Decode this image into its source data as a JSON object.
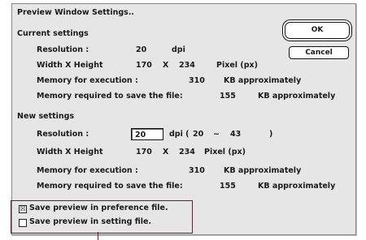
{
  "dialog": {
    "title": "Preview Window Settings..",
    "ok_label": "OK",
    "cancel_label": "Cancel"
  },
  "current": {
    "heading": "Current settings",
    "resolution_label": "Resolution :",
    "resolution_value": "20",
    "resolution_unit": "dpi",
    "wh_label": "Width X Height",
    "width": "170",
    "x_sep": "X",
    "height": "234",
    "wh_unit": "Pixel (px)",
    "mem_exec_label": "Memory for execution :",
    "mem_exec_value": "310",
    "mem_exec_unit": "KB approximately",
    "mem_save_label": "Memory required to save the file:",
    "mem_save_value": "155",
    "mem_save_unit": "KB approximately"
  },
  "new": {
    "heading": "New settings",
    "resolution_label": "Resolution :",
    "resolution_value": "20",
    "range_prefix": "dpi (",
    "range_min": "20",
    "range_sep": "~",
    "range_max": "43",
    "range_close": ")",
    "wh_label": "Width X Height",
    "width": "170",
    "x_sep": "X",
    "height": "234",
    "wh_unit": "Pixel (px)",
    "mem_exec_label": "Memory for execution :",
    "mem_exec_value": "310",
    "mem_exec_unit": "KB approximately",
    "mem_save_label": "Memory required to save the file:",
    "mem_save_value": "155",
    "mem_save_unit": "KB approximately"
  },
  "options": {
    "save_pref_label": "Save preview in preference file.",
    "save_pref_checked": true,
    "save_pref_mark": "☒",
    "save_setting_label": "Save preview in setting file.",
    "save_setting_checked": false
  }
}
